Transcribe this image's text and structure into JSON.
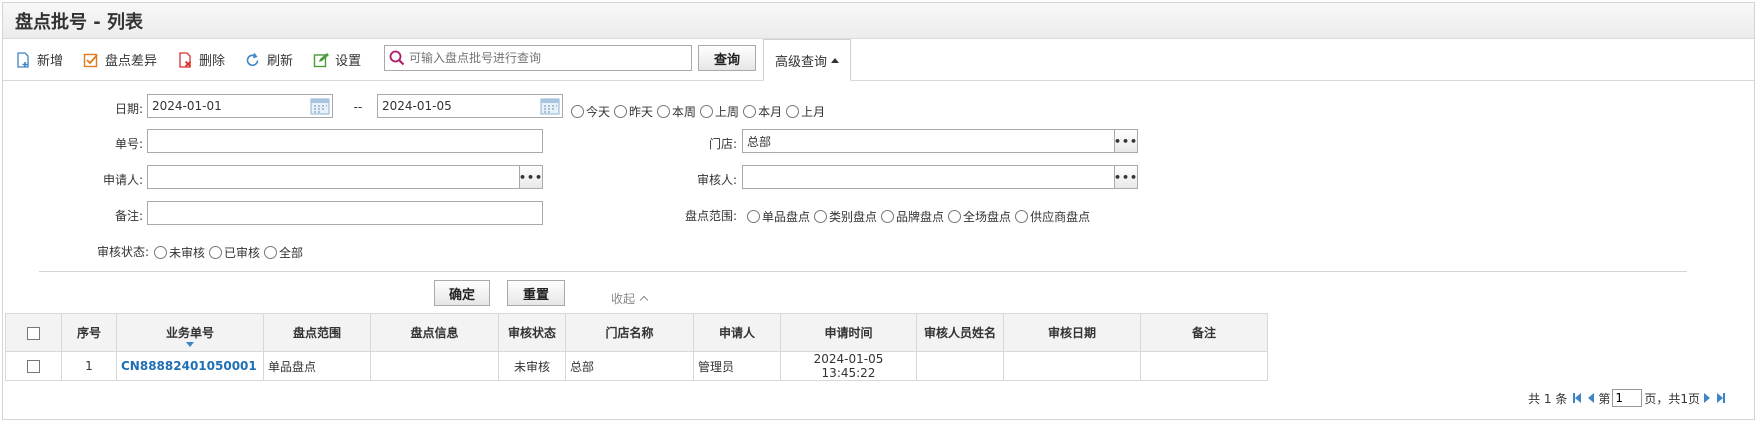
{
  "title": "盘点批号 - 列表",
  "toolbar": {
    "add_label": "新增",
    "diff_label": "盘点差异",
    "delete_label": "删除",
    "refresh_label": "刷新",
    "settings_label": "设置",
    "search_placeholder": "可输入盘点批号进行查询",
    "query_label": "查询",
    "advanced_label": "高级查询"
  },
  "filters": {
    "date_label": "日期:",
    "date_from": "2024-01-01",
    "date_sep": "--",
    "date_to": "2024-01-05",
    "date_presets": [
      "今天",
      "昨天",
      "本周",
      "上周",
      "本月",
      "上月"
    ],
    "order_no_label": "单号:",
    "order_no_value": "",
    "store_label": "门店:",
    "store_value": "总部",
    "applicant_label": "申请人:",
    "applicant_value": "",
    "reviewer_label": "审核人:",
    "reviewer_value": "",
    "remark_label": "备注:",
    "remark_value": "",
    "scope_label": "盘点范围:",
    "scope_options": [
      "单品盘点",
      "类别盘点",
      "品牌盘点",
      "全场盘点",
      "供应商盘点"
    ],
    "status_label": "审核状态:",
    "status_options": [
      "未审核",
      "已审核",
      "全部"
    ],
    "confirm_label": "确定",
    "reset_label": "重置",
    "collapse_label": "收起"
  },
  "table": {
    "columns": [
      "序号",
      "业务单号",
      "盘点范围",
      "盘点信息",
      "审核状态",
      "门店名称",
      "申请人",
      "申请时间",
      "审核人员姓名",
      "审核日期",
      "备注"
    ],
    "rows": [
      [
        "1",
        "CN88882401050001",
        "单品盘点",
        "",
        "未审核",
        "总部",
        "管理员",
        "2024-01-05 13:45:22",
        "",
        "",
        ""
      ]
    ]
  },
  "pager": {
    "total_text": "共 1 条",
    "page_prefix": "第",
    "page_value": "1",
    "page_suffix": "页，共1页"
  },
  "colors": {
    "link": "#1f6fb5",
    "header_bg": "#f3f3f3",
    "icon_blue": "#3f84c5",
    "icon_orange": "#e07b1f",
    "icon_red": "#d9302c",
    "icon_green": "#4a9b3a"
  }
}
